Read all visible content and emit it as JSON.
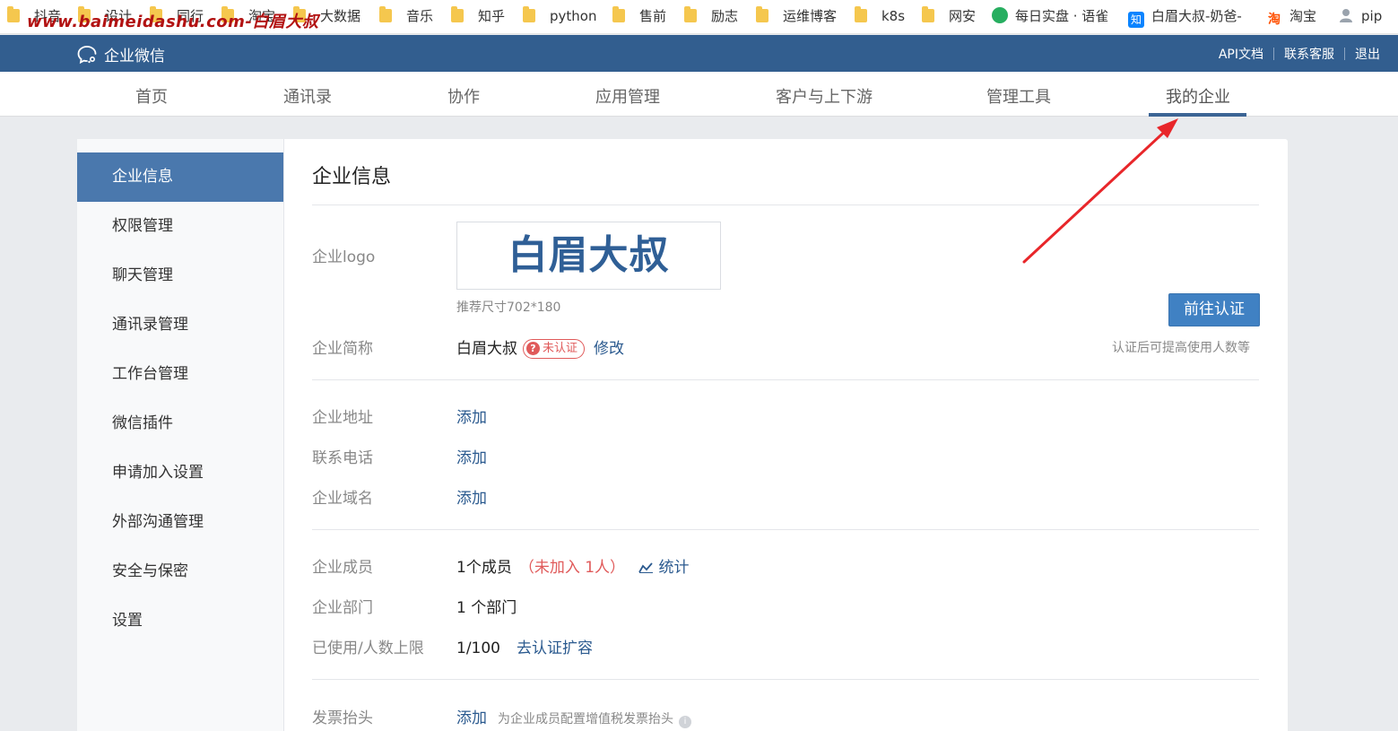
{
  "watermark": "www.baimeidashu.com-白眉大叔",
  "bookmarks": [
    {
      "label": "抖音",
      "icon": "folder-icon"
    },
    {
      "label": "设计",
      "icon": "folder-icon"
    },
    {
      "label": "同行",
      "icon": "folder-icon"
    },
    {
      "label": "淘宝",
      "icon": "folder-icon"
    },
    {
      "label": "大数据",
      "icon": "folder-icon"
    },
    {
      "label": "音乐",
      "icon": "folder-icon"
    },
    {
      "label": "知乎",
      "icon": "folder-icon"
    },
    {
      "label": "python",
      "icon": "folder-icon"
    },
    {
      "label": "售前",
      "icon": "folder-icon"
    },
    {
      "label": "励志",
      "icon": "folder-icon"
    },
    {
      "label": "运维博客",
      "icon": "folder-icon"
    },
    {
      "label": "k8s",
      "icon": "folder-icon"
    },
    {
      "label": "网安",
      "icon": "folder-icon"
    },
    {
      "label": "每日实盘 · 语雀",
      "icon": "yuque-icon"
    },
    {
      "label": "白眉大叔-奶爸-",
      "icon": "zhihu-icon",
      "icon_text": "知"
    },
    {
      "label": "淘宝",
      "icon": "taobao-icon",
      "icon_text": "淘"
    },
    {
      "label": "pip",
      "icon": "user-icon"
    }
  ],
  "header": {
    "app_name": "企业微信",
    "links": [
      "API文档",
      "联系客服",
      "退出"
    ]
  },
  "nav": {
    "items": [
      "首页",
      "通讯录",
      "协作",
      "应用管理",
      "客户与上下游",
      "管理工具",
      "我的企业"
    ],
    "active": "我的企业"
  },
  "sidebar": {
    "items": [
      "企业信息",
      "权限管理",
      "聊天管理",
      "通讯录管理",
      "工作台管理",
      "微信插件",
      "申请加入设置",
      "外部沟通管理",
      "安全与保密",
      "设置"
    ],
    "active": "企业信息"
  },
  "main": {
    "title": "企业信息",
    "logo_label": "企业logo",
    "logo_text": "白眉大叔",
    "logo_hint": "推荐尺寸702*180",
    "verify_button": "前往认证",
    "verify_hint": "认证后可提高使用人数等",
    "short_name_label": "企业简称",
    "short_name": "白眉大叔",
    "unverified_badge": "未认证",
    "modify_link": "修改",
    "address_label": "企业地址",
    "address_action": "添加",
    "phone_label": "联系电话",
    "phone_action": "添加",
    "domain_label": "企业域名",
    "domain_action": "添加",
    "members_label": "企业成员",
    "members_value": "1个成员",
    "members_not_joined": "（未加入 1人）",
    "stats_link": "统计",
    "departments_label": "企业部门",
    "departments_value": "1 个部门",
    "usage_label": "已使用/人数上限",
    "usage_value": "1/100",
    "expand_link": "去认证扩容",
    "invoice_label": "发票抬头",
    "invoice_action": "添加",
    "invoice_hint": "为企业成员配置增值税发票抬头"
  },
  "colors": {
    "header_bg": "#325e8f",
    "accent": "#4a78ad",
    "button": "#4081c3",
    "warning": "#e05a5a",
    "annotation_arrow": "#e8262a"
  }
}
